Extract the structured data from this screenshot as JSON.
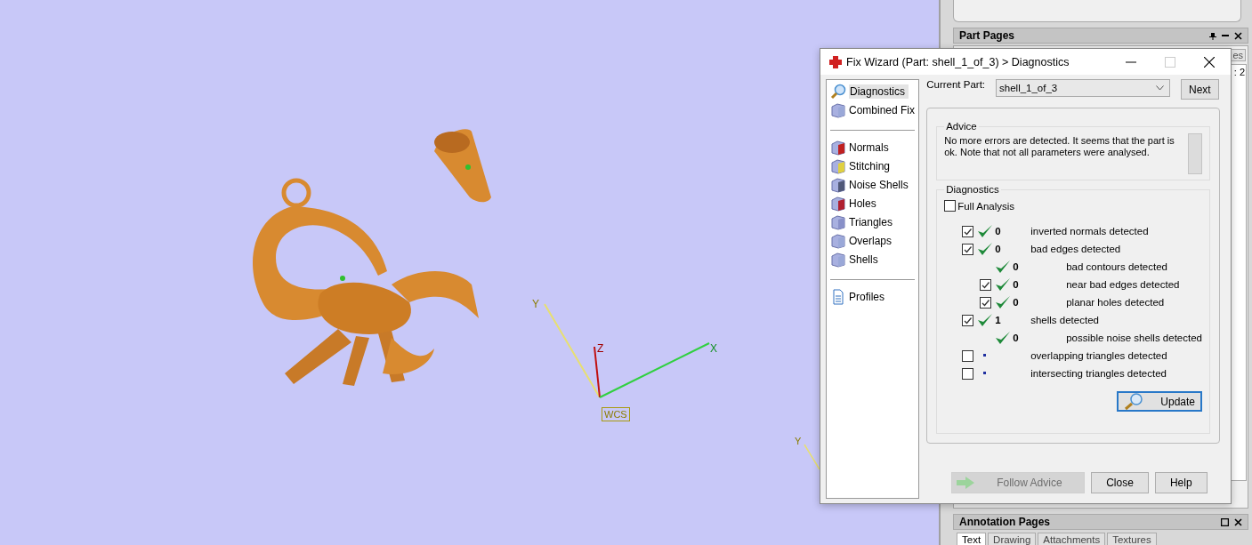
{
  "viewport": {
    "axis_labels": [
      {
        "kind": "y",
        "text": "Y"
      },
      {
        "kind": "z",
        "text": "Z"
      },
      {
        "kind": "x",
        "text": "X"
      }
    ],
    "frame_label": "WCS",
    "far_axis_label": "Y"
  },
  "right_panel": {
    "part_pages": {
      "title": "Part Pages",
      "tab_fragment": "es",
      "text_fragment": ": 2"
    },
    "annotation_pages": {
      "title": "Annotation Pages",
      "tabs": [
        {
          "label": "Text",
          "selected": true
        },
        {
          "label": "Drawing",
          "selected": false
        },
        {
          "label": "Attachments",
          "selected": false
        },
        {
          "label": "Textures",
          "selected": false
        }
      ]
    }
  },
  "dialog": {
    "title": "Fix Wizard (Part: shell_1_of_3) > Diagnostics",
    "sidebar_groups": [
      [
        {
          "label": "Diagnostics",
          "selected": true
        },
        {
          "label": "Combined Fix",
          "selected": false
        }
      ],
      [
        {
          "label": "Normals",
          "selected": false
        },
        {
          "label": "Stitching",
          "selected": false
        },
        {
          "label": "Noise Shells",
          "selected": false
        },
        {
          "label": "Holes",
          "selected": false
        },
        {
          "label": "Triangles",
          "selected": false
        },
        {
          "label": "Overlaps",
          "selected": false
        },
        {
          "label": "Shells",
          "selected": false
        }
      ],
      [
        {
          "label": "Profiles",
          "selected": false
        }
      ]
    ],
    "current_part_label": "Current Part:",
    "current_part": "shell_1_of_3",
    "next_button": "Next",
    "advice": {
      "title": "Advice",
      "text": "No more errors are detected. It seems that the part is ok. Note that not all parameters were analysed."
    },
    "diagnostics": {
      "title": "Diagnostics",
      "full_analysis": {
        "label": "Full Analysis",
        "checked": false
      },
      "rows": [
        {
          "kind": "main",
          "checked": true,
          "passed": true,
          "count": "0",
          "label": "inverted normals detected"
        },
        {
          "kind": "main",
          "checked": true,
          "passed": true,
          "count": "0",
          "label": "bad edges detected"
        },
        {
          "kind": "sub-plain",
          "passed": true,
          "count": "0",
          "label": "bad contours detected"
        },
        {
          "kind": "sub",
          "checked": true,
          "passed": true,
          "count": "0",
          "label": "near bad edges detected"
        },
        {
          "kind": "sub",
          "checked": true,
          "passed": true,
          "count": "0",
          "label": "planar holes detected"
        },
        {
          "kind": "main",
          "checked": true,
          "passed": true,
          "count": "1",
          "label": "shells detected"
        },
        {
          "kind": "sub-plain",
          "passed": true,
          "count": "0",
          "label": "possible noise shells detected"
        },
        {
          "kind": "main",
          "checked": false,
          "passed": false,
          "label": "overlapping triangles detected"
        },
        {
          "kind": "main",
          "checked": false,
          "passed": false,
          "label": "intersecting triangles detected"
        }
      ],
      "update_button": "Update"
    },
    "buttons": [
      {
        "kind": "follow",
        "label": "Follow Advice",
        "disabled": true
      },
      {
        "kind": "plain",
        "label": "Close",
        "disabled": false
      },
      {
        "kind": "plain",
        "label": "Help",
        "disabled": false
      }
    ]
  }
}
